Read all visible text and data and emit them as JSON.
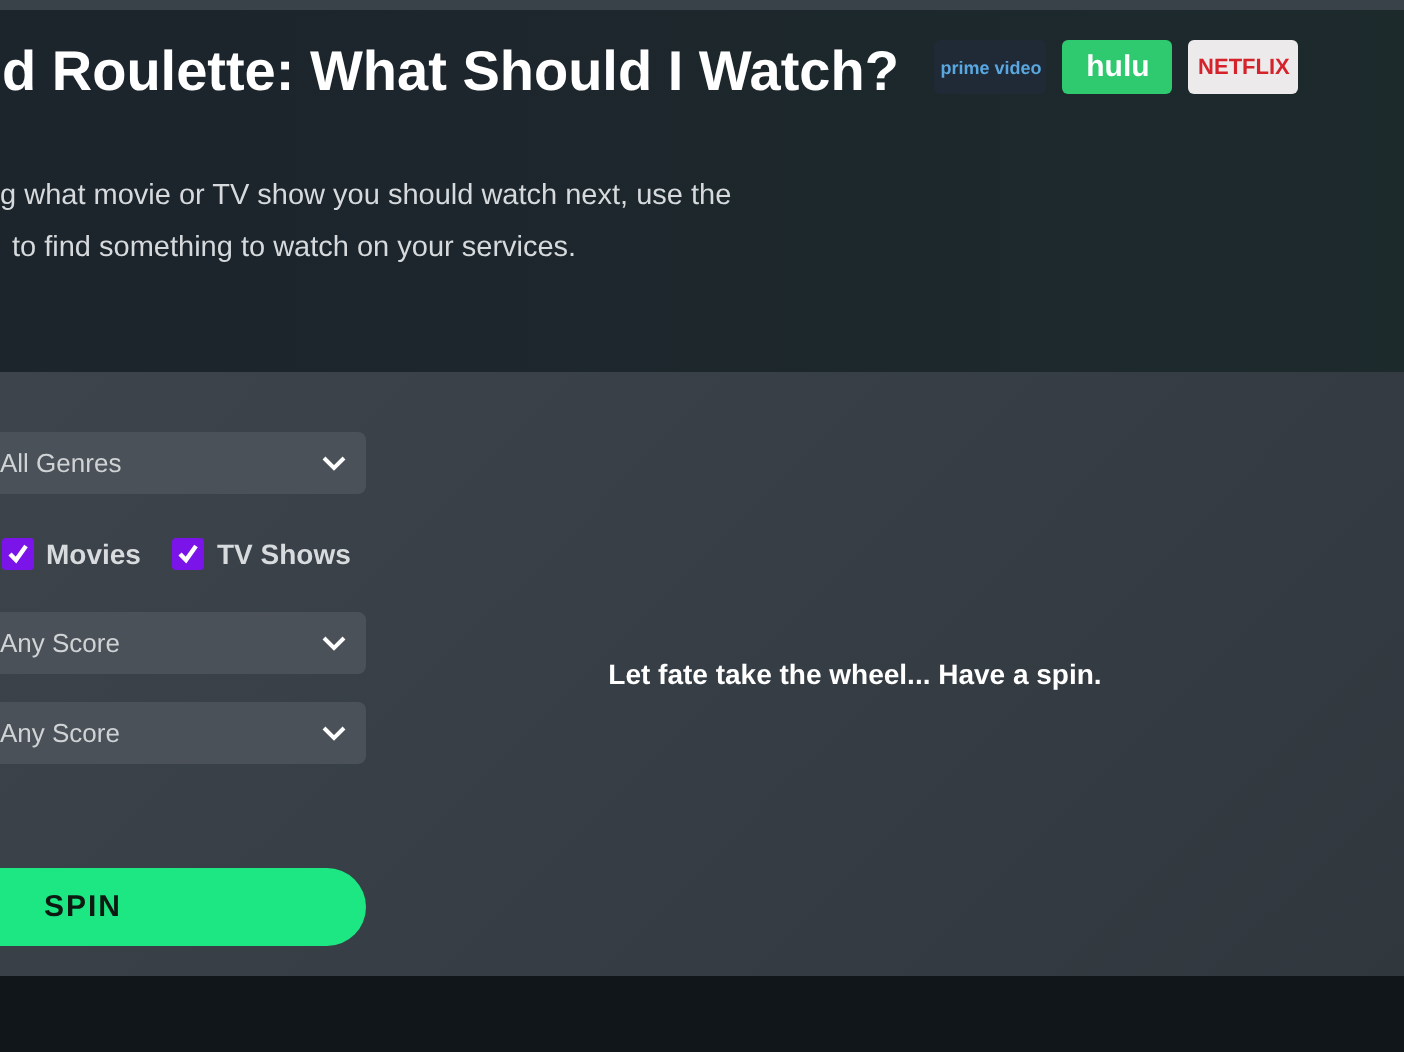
{
  "header": {
    "title": "d Roulette: What Should I Watch?",
    "services": [
      {
        "kind": "prime",
        "label": "prime video"
      },
      {
        "kind": "hulu",
        "label": "hulu"
      },
      {
        "kind": "netflix",
        "label": "NETFLIX"
      }
    ],
    "description": [
      "g what movie or TV show you should watch next, use the",
      "to find something to watch on your services."
    ]
  },
  "filters": {
    "genre": {
      "value": "All Genres"
    },
    "types": [
      {
        "label": "Movies",
        "checked": true
      },
      {
        "label": "TV Shows",
        "checked": true
      }
    ],
    "scores": [
      {
        "value": "Any Score"
      },
      {
        "value": "Any Score"
      }
    ],
    "spin_button": "SPIN"
  },
  "result_message": "Let fate take the wheel... Have a spin."
}
